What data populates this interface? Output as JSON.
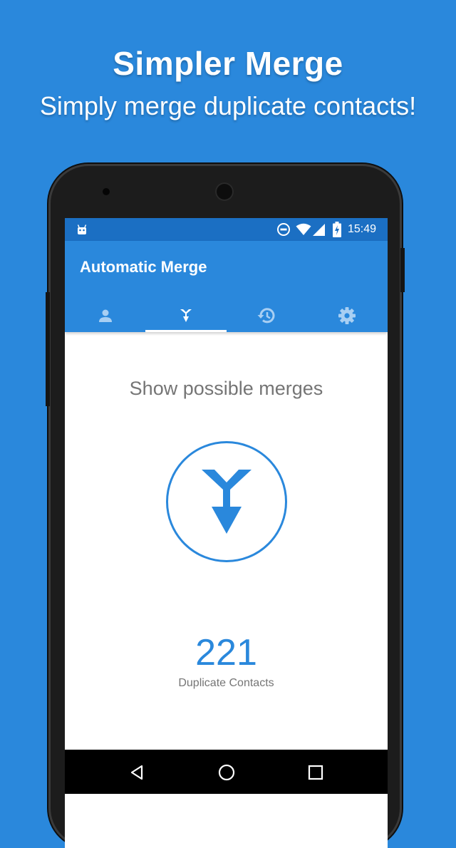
{
  "promo": {
    "title": "Simpler Merge",
    "subtitle": "Simply merge duplicate contacts!"
  },
  "status_bar": {
    "time": "15:49",
    "icons": [
      "android-robot-icon",
      "do-not-disturb-icon",
      "wifi-icon",
      "cell-signal-icon",
      "battery-charging-icon"
    ]
  },
  "app_bar": {
    "title": "Automatic Merge"
  },
  "tabs": [
    {
      "icon": "person-icon",
      "selected": false
    },
    {
      "icon": "merge-icon",
      "selected": true
    },
    {
      "icon": "history-icon",
      "selected": false
    },
    {
      "icon": "settings-gear-icon",
      "selected": false
    }
  ],
  "main": {
    "heading": "Show possible merges",
    "duplicate_count": "221",
    "duplicate_label": "Duplicate Contacts"
  },
  "nav_bar": {
    "buttons": [
      "back-icon",
      "home-icon",
      "recents-icon"
    ]
  },
  "colors": {
    "primary": "#2a88dc",
    "status_bar": "#1b6fc3",
    "text_secondary": "#757575"
  }
}
